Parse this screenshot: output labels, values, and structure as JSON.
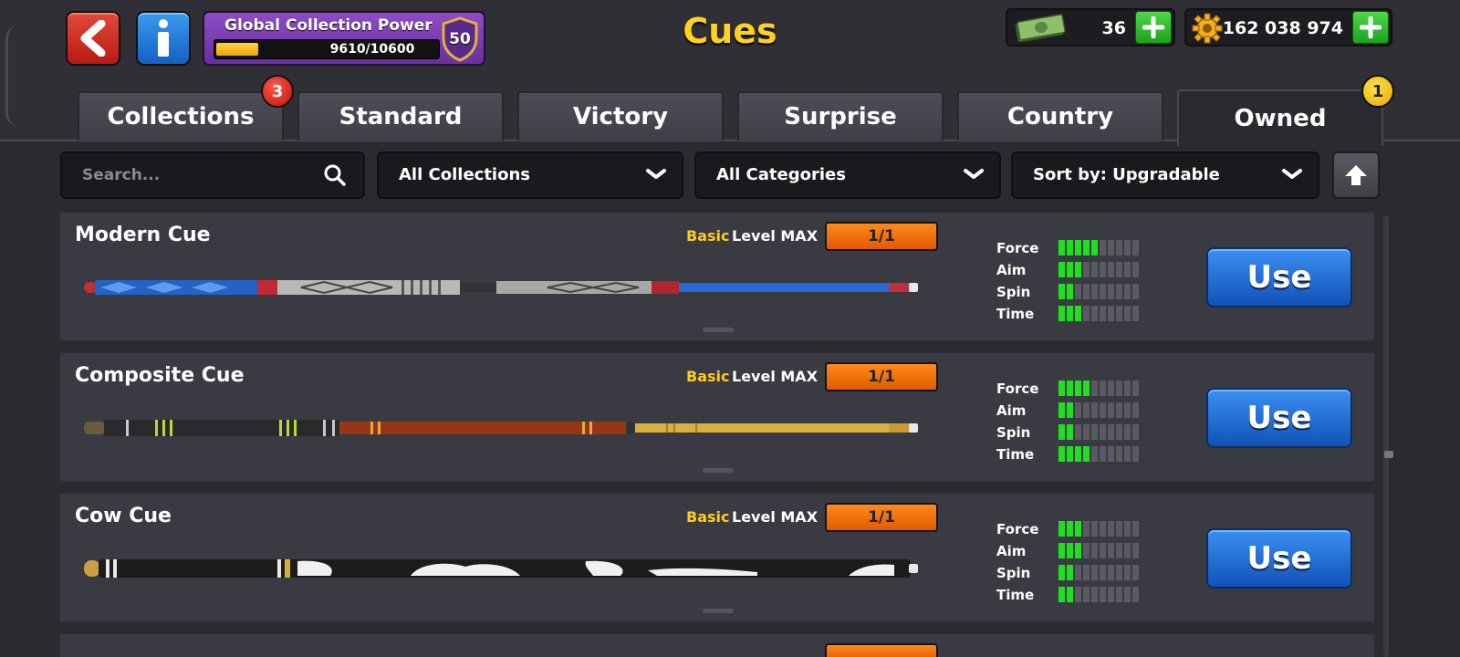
{
  "header": {
    "title": "Cues",
    "collection_power": {
      "label": "Global Collection Power",
      "value": "9610/10600",
      "progress": 0.19,
      "level": "50"
    },
    "cash": {
      "value": "36"
    },
    "coins": {
      "value": "162 038 974"
    }
  },
  "tabs": [
    {
      "label": "Collections",
      "badge": "3"
    },
    {
      "label": "Standard"
    },
    {
      "label": "Victory"
    },
    {
      "label": "Surprise"
    },
    {
      "label": "Country"
    },
    {
      "label": "Owned",
      "badge": "1",
      "active": true
    }
  ],
  "filters": {
    "search_placeholder": "Search...",
    "collection": "All Collections",
    "category": "All Categories",
    "sort": "Sort by: Upgradable"
  },
  "cues": [
    {
      "name": "Modern Cue",
      "rarity": "Basic",
      "level_label": "Level MAX",
      "level": "1/1",
      "stats": {
        "force": 5,
        "aim": 3,
        "spin": 2,
        "time": 3
      },
      "action": "Use"
    },
    {
      "name": "Composite Cue",
      "rarity": "Basic",
      "level_label": "Level MAX",
      "level": "1/1",
      "stats": {
        "force": 4,
        "aim": 2,
        "spin": 2,
        "time": 4
      },
      "action": "Use"
    },
    {
      "name": "Cow Cue",
      "rarity": "Basic",
      "level_label": "Level MAX",
      "level": "1/1",
      "stats": {
        "force": 3,
        "aim": 3,
        "spin": 2,
        "time": 2
      },
      "action": "Use"
    }
  ],
  "stat_labels": [
    "Force",
    "Aim",
    "Spin",
    "Time"
  ],
  "colors": {
    "title": "#ffd21f",
    "rarity_basic": "#ffcc1a",
    "stat_on": "#1ee01e",
    "use_button": "#1f6fd8",
    "level_box": "#f27a0c"
  }
}
